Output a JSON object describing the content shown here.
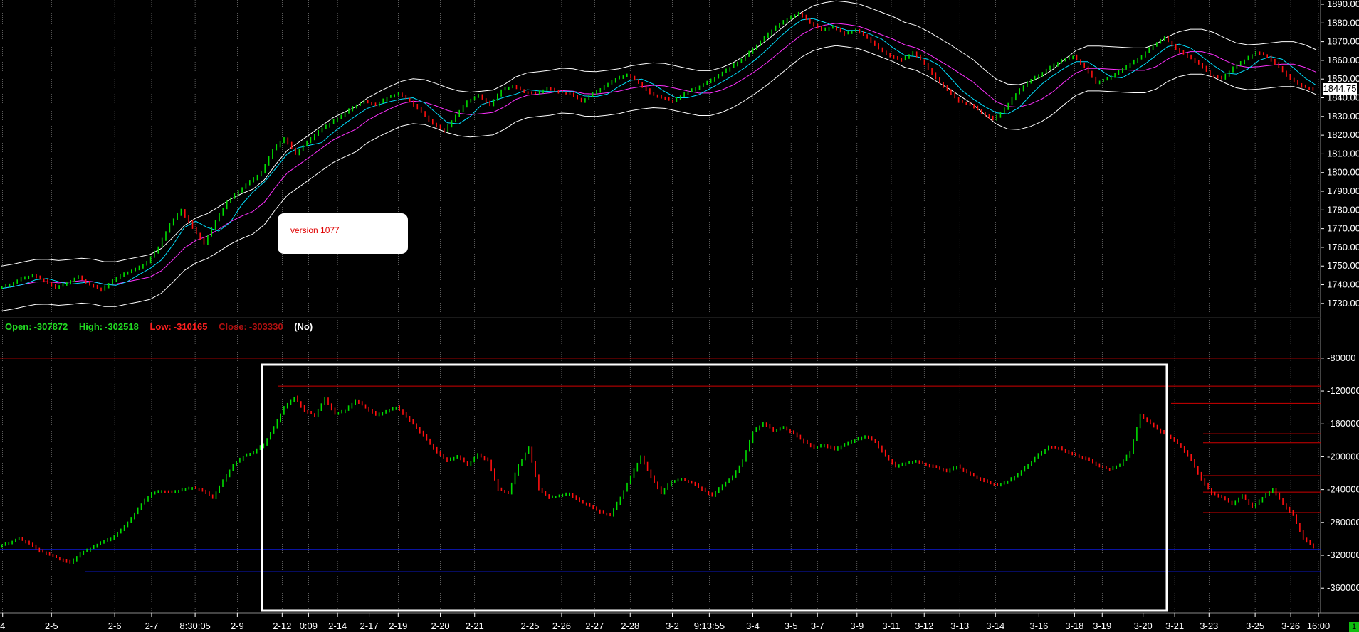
{
  "chart_data": [
    {
      "type": "line",
      "panel": "price",
      "ylim": [
        1725,
        1890
      ],
      "y_ticks": [
        "1890.00",
        "1880.00",
        "1870.00",
        "1860.00",
        "1850.00",
        "1840.00",
        "1830.00",
        "1820.00",
        "1810.00",
        "1800.00",
        "1790.00",
        "1780.00",
        "1770.00",
        "1760.00",
        "1750.00",
        "1740.00",
        "1730.00"
      ],
      "last_price": "1844.75",
      "series": [
        {
          "values": [
            1738,
            1740,
            1743,
            1745,
            1742,
            1738,
            1741,
            1744,
            1740,
            1737,
            1742,
            1746,
            1748,
            1752,
            1760,
            1772,
            1780,
            1770,
            1762,
            1774,
            1784,
            1790,
            1795,
            1800,
            1812,
            1818,
            1810,
            1816,
            1822,
            1826,
            1830,
            1835,
            1838,
            1836,
            1840,
            1842,
            1838,
            1832,
            1826,
            1822,
            1830,
            1838,
            1841,
            1836,
            1844,
            1846,
            1843,
            1842,
            1845,
            1843,
            1842,
            1838,
            1842,
            1846,
            1850,
            1852,
            1848,
            1842,
            1840,
            1838,
            1842,
            1845,
            1848,
            1852,
            1856,
            1860,
            1866,
            1872,
            1878,
            1882,
            1885,
            1880,
            1876,
            1878,
            1874,
            1876,
            1872,
            1866,
            1862,
            1860,
            1864,
            1858,
            1850,
            1844,
            1838,
            1836,
            1832,
            1828,
            1834,
            1842,
            1848,
            1852,
            1856,
            1860,
            1862,
            1856,
            1848,
            1850,
            1854,
            1858,
            1862,
            1868,
            1872,
            1866,
            1862,
            1858,
            1852,
            1850,
            1856,
            1860,
            1864,
            1862,
            1856,
            1850,
            1846,
            1844
          ]
        }
      ]
    },
    {
      "type": "line",
      "panel": "indicator",
      "ylim": [
        -378000,
        -68000
      ],
      "y_ticks": [
        "-80000",
        "-120000",
        "-160000",
        "-200000",
        "-240000",
        "-280000",
        "-320000",
        "-360000"
      ],
      "series": [
        {
          "values": [
            -310000,
            -305000,
            -300000,
            -306000,
            -315000,
            -320000,
            -325000,
            -330000,
            -318000,
            -312000,
            -305000,
            -300000,
            -290000,
            -275000,
            -258000,
            -245000,
            -242000,
            -244000,
            -240000,
            -238000,
            -242000,
            -250000,
            -230000,
            -210000,
            -200000,
            -195000,
            -185000,
            -165000,
            -140000,
            -128000,
            -145000,
            -150000,
            -130000,
            -148000,
            -144000,
            -132000,
            -140000,
            -150000,
            -145000,
            -140000,
            -152000,
            -165000,
            -180000,
            -195000,
            -205000,
            -200000,
            -210000,
            -198000,
            -205000,
            -240000,
            -245000,
            -210000,
            -190000,
            -240000,
            -250000,
            -248000,
            -245000,
            -255000,
            -260000,
            -268000,
            -272000,
            -250000,
            -225000,
            -200000,
            -225000,
            -245000,
            -230000,
            -228000,
            -232000,
            -240000,
            -248000,
            -235000,
            -225000,
            -205000,
            -170000,
            -160000,
            -168000,
            -165000,
            -172000,
            -182000,
            -190000,
            -186000,
            -192000,
            -185000,
            -180000,
            -176000,
            -182000,
            -200000,
            -212000,
            -208000,
            -206000,
            -210000,
            -214000,
            -218000,
            -212000,
            -220000,
            -226000,
            -232000,
            -235000,
            -230000,
            -222000,
            -210000,
            -198000,
            -188000,
            -190000,
            -196000,
            -200000,
            -205000,
            -212000,
            -216000,
            -210000,
            -195000,
            -150000,
            -160000,
            -170000,
            -178000,
            -188000,
            -205000,
            -228000,
            -245000,
            -250000,
            -258000,
            -248000,
            -262000,
            -250000,
            -240000,
            -258000,
            -272000,
            -300000,
            -310165
          ]
        }
      ],
      "hlines_red": [
        -80000,
        -114000,
        -135000,
        -172000,
        -183000,
        -223000,
        -243000,
        -268000
      ],
      "hlines_blue": [
        -313000,
        -340000
      ]
    }
  ],
  "info": {
    "open_label": "Open:",
    "open_value": "-307872",
    "high_label": "High:",
    "high_value": "-302518",
    "low_label": "Low:",
    "low_value": "-310165",
    "close_label": "Close:",
    "close_value": "-303330",
    "flag": "(No)"
  },
  "version_text": "version 1077",
  "corner_tag": "1",
  "time_labels": [
    {
      "t": 0.002,
      "label": "4"
    },
    {
      "t": 0.039,
      "label": "2-5"
    },
    {
      "t": 0.087,
      "label": "2-6"
    },
    {
      "t": 0.115,
      "label": "2-7"
    },
    {
      "t": 0.148,
      "label": "8:30:05"
    },
    {
      "t": 0.18,
      "label": "2-9"
    },
    {
      "t": 0.214,
      "label": "2-12"
    },
    {
      "t": 0.234,
      "label": "0:09"
    },
    {
      "t": 0.256,
      "label": "2-14"
    },
    {
      "t": 0.28,
      "label": "2-17"
    },
    {
      "t": 0.302,
      "label": "2-19"
    },
    {
      "t": 0.334,
      "label": "2-20"
    },
    {
      "t": 0.36,
      "label": "2-21"
    },
    {
      "t": 0.402,
      "label": "2-25"
    },
    {
      "t": 0.426,
      "label": "2-26"
    },
    {
      "t": 0.451,
      "label": "2-27"
    },
    {
      "t": 0.478,
      "label": "2-28"
    },
    {
      "t": 0.51,
      "label": "3-2"
    },
    {
      "t": 0.538,
      "label": "9:13:55"
    },
    {
      "t": 0.571,
      "label": "3-4"
    },
    {
      "t": 0.6,
      "label": "3-5"
    },
    {
      "t": 0.62,
      "label": "3-7"
    },
    {
      "t": 0.65,
      "label": "3-9"
    },
    {
      "t": 0.676,
      "label": "3-11"
    },
    {
      "t": 0.701,
      "label": "3-12"
    },
    {
      "t": 0.728,
      "label": "3-13"
    },
    {
      "t": 0.755,
      "label": "3-14"
    },
    {
      "t": 0.788,
      "label": "3-16"
    },
    {
      "t": 0.815,
      "label": "3-18"
    },
    {
      "t": 0.836,
      "label": "3-19"
    },
    {
      "t": 0.867,
      "label": "3-20"
    },
    {
      "t": 0.891,
      "label": "3-21"
    },
    {
      "t": 0.917,
      "label": "3-23"
    },
    {
      "t": 0.952,
      "label": "3-25"
    },
    {
      "t": 0.979,
      "label": "3-26"
    },
    {
      "t": 1.0,
      "label": "16:00"
    }
  ],
  "colors": {
    "up_bar": "#00dd00",
    "down_bar": "#ff1010",
    "band": "#ffffff",
    "ma_cyan": "#00e0ff",
    "ma_magenta": "#ff30ff",
    "grid": "#9a9a9a",
    "hline_red": "#d00000",
    "hline_blue": "#1020ff",
    "axis_text": "#ffffff",
    "open_color": "#22dd22",
    "low_color": "#ff2020",
    "close_color": "#b01010"
  }
}
